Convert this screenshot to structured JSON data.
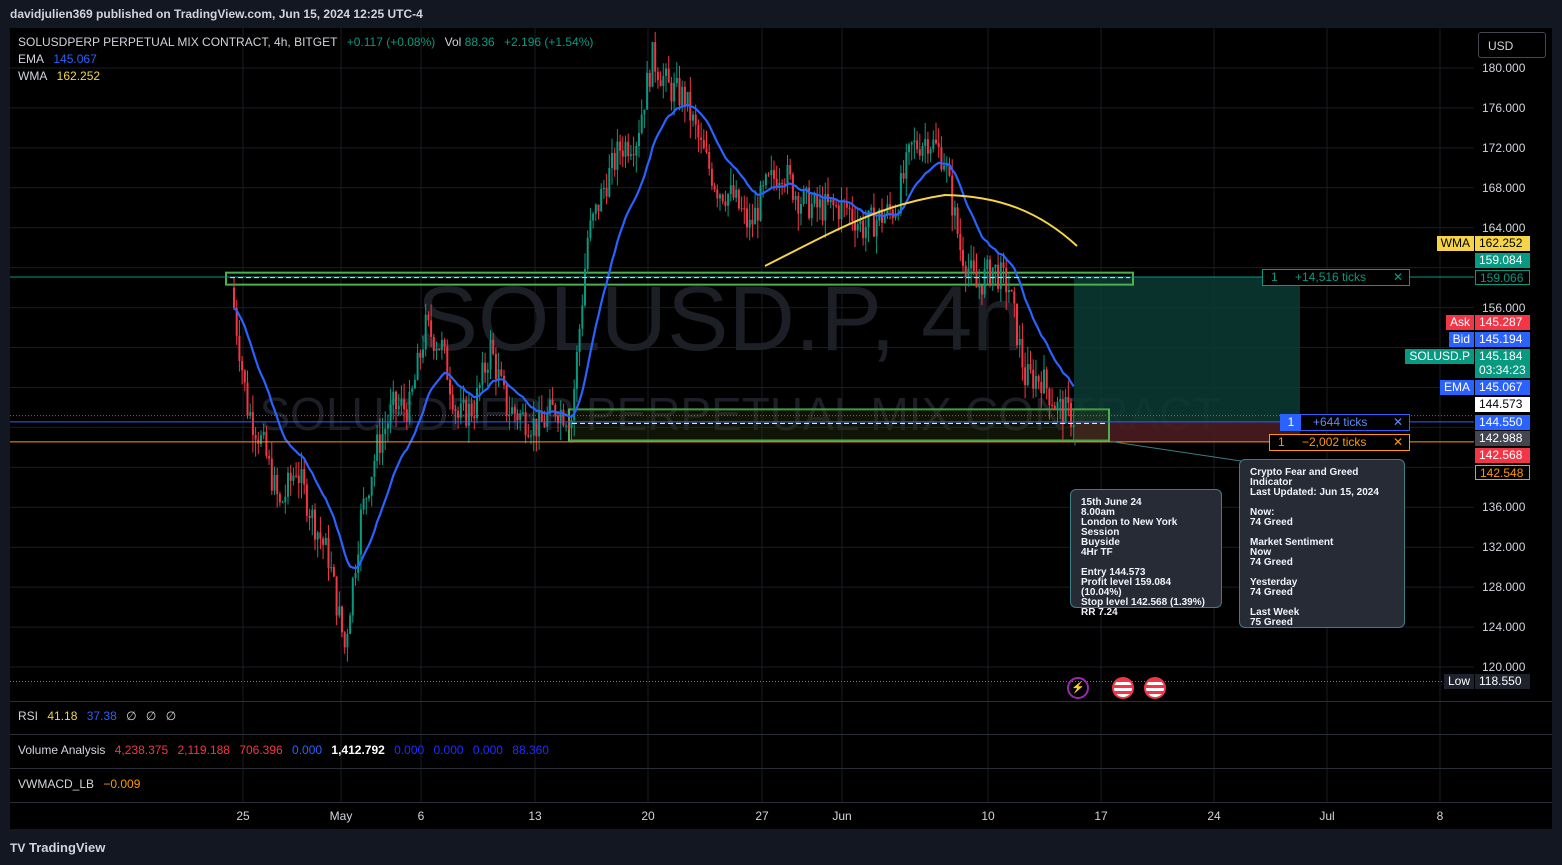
{
  "header": {
    "publisher": "davidjulien369 published on TradingView.com, Jun 15, 2024 12:25 UTC-4"
  },
  "legend": {
    "symbol": "SOLUSDPERP PERPETUAL MIX CONTRACT, 4h, BITGET",
    "change": "+0.117 (+0.08%)",
    "vol_label": "Vol",
    "vol_value": "88.36",
    "vol_change": "+2.196 (+1.54%)",
    "ema_label": "EMA",
    "ema_value": "145.067",
    "wma_label": "WMA",
    "wma_value": "162.252"
  },
  "watermark": {
    "main": "SOLUSD.P, 4h",
    "sub": "SOLUSDPERP PERPETUAL MIX CONTRACT"
  },
  "currency_button": "USD",
  "price_axis": {
    "ticks": [
      "180.000",
      "176.000",
      "172.000",
      "168.000",
      "164.000",
      "156.000",
      "136.000",
      "132.000",
      "128.000",
      "124.000",
      "120.000"
    ],
    "labels": [
      {
        "name": "WMA",
        "value": "162.252",
        "color": "#f5d547",
        "text_color": "#000"
      },
      {
        "name": "",
        "value": "159.084",
        "color": "#089981",
        "text_color": "#fff"
      },
      {
        "name": "",
        "value": "159.066",
        "color": "#000",
        "text_color": "#089981"
      },
      {
        "name": "Ask",
        "value": "145.287",
        "color": "#f23645",
        "text_color": "#fff"
      },
      {
        "name": "Bid",
        "value": "145.194",
        "color": "#2962ff",
        "text_color": "#fff"
      },
      {
        "name": "SOLUSD.P",
        "value": "145.184",
        "color": "#089981",
        "text_color": "#fff"
      },
      {
        "name": "",
        "value": "03:34:23",
        "color": "#089981",
        "text_color": "#fff"
      },
      {
        "name": "EMA",
        "value": "145.067",
        "color": "#2962ff",
        "text_color": "#fff"
      },
      {
        "name": "",
        "value": "144.573",
        "color": "#fff",
        "text_color": "#000"
      },
      {
        "name": "",
        "value": "144.550",
        "color": "#2962ff",
        "text_color": "#fff"
      },
      {
        "name": "",
        "value": "142.988",
        "color": "#434651",
        "text_color": "#fff"
      },
      {
        "name": "",
        "value": "142.568",
        "color": "#f23645",
        "text_color": "#fff"
      },
      {
        "name": "",
        "value": "142.548",
        "color": "#000",
        "text_color": "#ff9800"
      },
      {
        "name": "Low",
        "value": "118.550",
        "color": "#1e222d",
        "text_color": "#fff"
      }
    ]
  },
  "time_axis": [
    "25",
    "May",
    "6",
    "13",
    "20",
    "27",
    "Jun",
    "10",
    "17",
    "24",
    "Jul",
    "8"
  ],
  "ticks_labels": {
    "top": {
      "qty": "1",
      "text": "+14,516 ticks",
      "close": "✕"
    },
    "mid": {
      "qty": "1",
      "text": "+644 ticks",
      "close": "✕"
    },
    "low": {
      "qty": "1",
      "text": "−2,002 ticks",
      "close": "✕"
    }
  },
  "note_trade": "15th June 24\n8.00am\nLondon to New York Session\nBuyside\n4Hr TF\n\nEntry 144.573\nProfit level 159.084 (10.04%)\nStop level 142.568 (1.39%)\nRR 7.24",
  "note_fng": "Crypto Fear and Greed Indicator\nLast Updated: Jun 15, 2024\n\nNow:\n74 Greed\n\nMarket Sentiment\nNow\n74 Greed\n\nYesterday\n74 Greed\n\nLast Week\n75 Greed",
  "panes": {
    "rsi": {
      "label": "RSI",
      "v1": "41.18",
      "v2": "37.38",
      "v3": "∅",
      "v4": "∅",
      "v5": "∅"
    },
    "volume": {
      "label": "Volume Analysis",
      "v1": "4,238.375",
      "v2": "2,119.188",
      "v3": "706.396",
      "v4": "0.000",
      "v5": "1,412.792",
      "v6": "0.000",
      "v7": "0.000",
      "v8": "0.000",
      "v9": "88.360"
    },
    "vwmacd": {
      "label": "VWMACD_LB",
      "v1": "−0.009"
    }
  },
  "footer": {
    "brand": "TradingView"
  },
  "colors": {
    "up": "#089981",
    "down": "#f23645",
    "ema": "#2962ff",
    "wma": "#f5d547",
    "zone": "#4caf50"
  },
  "chart_data": {
    "type": "candlestick",
    "title": "SOLUSDPERP PERPETUAL MIX CONTRACT, 4h, BITGET",
    "ylim": [
      118,
      182
    ],
    "x_labels": [
      "25",
      "May",
      "6",
      "13",
      "20",
      "27",
      "Jun",
      "10",
      "17",
      "24",
      "Jul",
      "8"
    ],
    "price_path": [
      {
        "x": "Apr 24",
        "y": 158
      },
      {
        "x": "Apr 25",
        "y": 146
      },
      {
        "x": "Apr 26",
        "y": 142
      },
      {
        "x": "Apr 27",
        "y": 136
      },
      {
        "x": "Apr 28",
        "y": 140
      },
      {
        "x": "Apr 29",
        "y": 135
      },
      {
        "x": "Apr 30",
        "y": 131
      },
      {
        "x": "May 1",
        "y": 122
      },
      {
        "x": "May 2",
        "y": 135
      },
      {
        "x": "May 3",
        "y": 142
      },
      {
        "x": "May 4",
        "y": 146
      },
      {
        "x": "May 5",
        "y": 146
      },
      {
        "x": "May 6",
        "y": 154
      },
      {
        "x": "May 7",
        "y": 152
      },
      {
        "x": "May 8",
        "y": 145
      },
      {
        "x": "May 9",
        "y": 146
      },
      {
        "x": "May 10",
        "y": 152
      },
      {
        "x": "May 11",
        "y": 146
      },
      {
        "x": "May 12",
        "y": 145
      },
      {
        "x": "May 13",
        "y": 144
      },
      {
        "x": "May 14",
        "y": 146
      },
      {
        "x": "May 15",
        "y": 145
      },
      {
        "x": "May 16",
        "y": 163
      },
      {
        "x": "May 17",
        "y": 168
      },
      {
        "x": "May 18",
        "y": 172
      },
      {
        "x": "May 19",
        "y": 173
      },
      {
        "x": "May 20",
        "y": 181
      },
      {
        "x": "May 21",
        "y": 178
      },
      {
        "x": "May 22",
        "y": 177
      },
      {
        "x": "May 23",
        "y": 172
      },
      {
        "x": "May 24",
        "y": 168
      },
      {
        "x": "May 25",
        "y": 167
      },
      {
        "x": "May 26",
        "y": 164
      },
      {
        "x": "May 27",
        "y": 168
      },
      {
        "x": "May 28",
        "y": 170
      },
      {
        "x": "May 29",
        "y": 167
      },
      {
        "x": "May 30",
        "y": 166
      },
      {
        "x": "May 31",
        "y": 166
      },
      {
        "x": "Jun 1",
        "y": 166
      },
      {
        "x": "Jun 2",
        "y": 164
      },
      {
        "x": "Jun 3",
        "y": 165
      },
      {
        "x": "Jun 4",
        "y": 166
      },
      {
        "x": "Jun 5",
        "y": 172
      },
      {
        "x": "Jun 6",
        "y": 173
      },
      {
        "x": "Jun 7",
        "y": 171
      },
      {
        "x": "Jun 8",
        "y": 162
      },
      {
        "x": "Jun 9",
        "y": 158
      },
      {
        "x": "Jun 10",
        "y": 160
      },
      {
        "x": "Jun 11",
        "y": 158
      },
      {
        "x": "Jun 12",
        "y": 149
      },
      {
        "x": "Jun 13",
        "y": 149
      },
      {
        "x": "Jun 14",
        "y": 146
      },
      {
        "x": "Jun 15",
        "y": 145
      }
    ],
    "levels": {
      "entry": 144.573,
      "profit": 159.084,
      "stop": 142.568,
      "low": 118.55
    }
  }
}
